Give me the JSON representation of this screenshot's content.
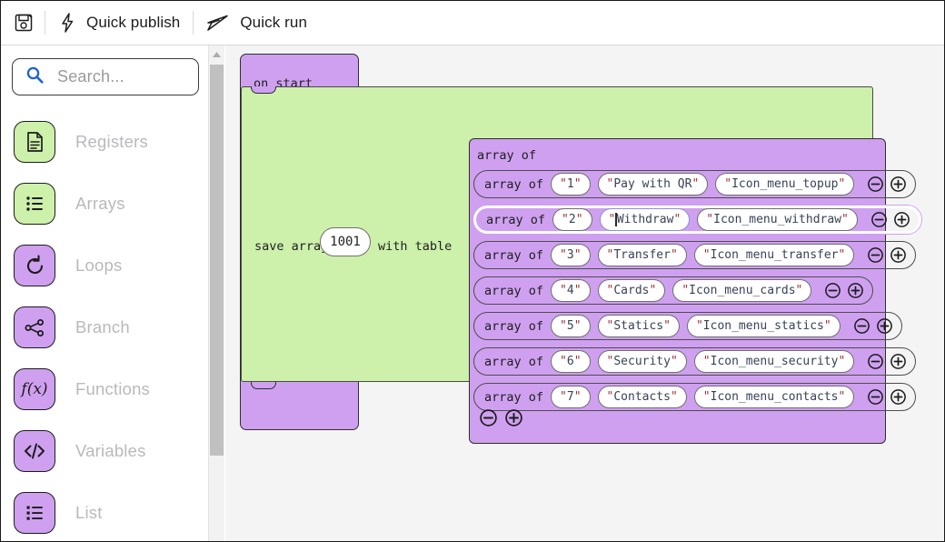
{
  "toolbar": {
    "save_icon": "save-disk-icon",
    "items": [
      {
        "label": "Quick publish",
        "icon": "lightning-bolt-icon"
      },
      {
        "label": "Quick run",
        "icon": "paper-plane-icon"
      }
    ]
  },
  "sidebar": {
    "search": {
      "placeholder": "Search...",
      "value": "",
      "icon": "search-icon"
    },
    "items": [
      {
        "label": "Registers",
        "icon": "document-icon",
        "color": "#cdf0ab"
      },
      {
        "label": "Arrays",
        "icon": "list-icon",
        "color": "#cdf0ab"
      },
      {
        "label": "Loops",
        "icon": "loop-icon",
        "color": "#cfa0f0"
      },
      {
        "label": "Branch",
        "icon": "branch-icon",
        "color": "#cfa0f0"
      },
      {
        "label": "Functions",
        "icon": "function-icon",
        "color": "#cfa0f0"
      },
      {
        "label": "Variables",
        "icon": "code-icon",
        "color": "#cfa0f0"
      },
      {
        "label": "List",
        "icon": "list-icon",
        "color": "#cfa0f0"
      }
    ],
    "scrollbar": {
      "arrow_icon": "chevron-up-icon"
    }
  },
  "canvas": {
    "on_start": {
      "label": "on start",
      "color": "#cfa0f0"
    },
    "save_array": {
      "prefix": "save array",
      "number_value": "1001",
      "suffix": "with table",
      "color": "#cdf0ab"
    },
    "array_block": {
      "title": "array of",
      "color": "#cfa0f0",
      "row_label": "array of",
      "minus_icon": "minus-circle-icon",
      "plus_icon": "plus-circle-icon",
      "rows": [
        {
          "index": "1",
          "name": "Pay with QR",
          "icon_name": "Icon_menu_topup",
          "selected": false
        },
        {
          "index": "2",
          "name": "Withdraw",
          "icon_name": "Icon_menu_withdraw",
          "selected": true
        },
        {
          "index": "3",
          "name": "Transfer",
          "icon_name": "Icon_menu_transfer",
          "selected": false
        },
        {
          "index": "4",
          "name": "Cards",
          "icon_name": "Icon_menu_cards",
          "selected": false
        },
        {
          "index": "5",
          "name": "Statics",
          "icon_name": "Icon_menu_statics",
          "selected": false
        },
        {
          "index": "6",
          "name": "Security",
          "icon_name": "Icon_menu_security",
          "selected": false
        },
        {
          "index": "7",
          "name": "Contacts",
          "icon_name": "Icon_menu_contacts",
          "selected": false
        }
      ]
    }
  }
}
